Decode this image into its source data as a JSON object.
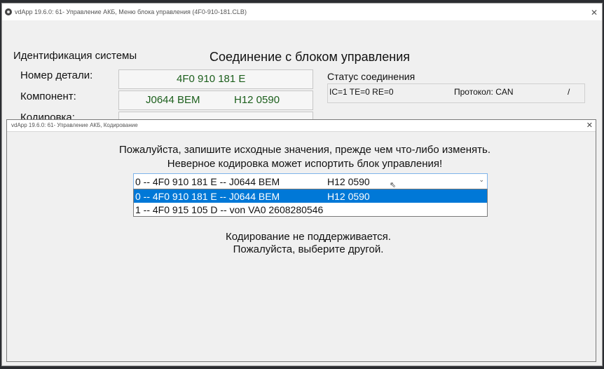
{
  "main_window": {
    "title": "vdApp 19.6.0: 61- Управление АКБ,  Меню блока управления (4F0-910-181.CLB)",
    "system_ident_label": "Идентификация системы",
    "connection_title": "Соединение с блоком управления",
    "part_number": {
      "label": "Номер детали:",
      "value": "4F0 910 181 E"
    },
    "component": {
      "label": "Компонент:",
      "name": "J0644 BEM",
      "version": "H12 0590"
    },
    "coding": {
      "label": "Кодировка:"
    },
    "status": {
      "title": "Статус соединения",
      "counters": "IC=1  TE=0   RE=0",
      "protocol": "Протокол: CAN",
      "spinner": "/"
    }
  },
  "dialog": {
    "title": "vdApp 19.6.0: 61- Управление АКБ,  Кодирование",
    "warning_line1": "Пожалуйста, запишите исходные значения, прежде чем что-либо изменять.",
    "warning_line2": "Неверное кодировка может испортить блок управления!",
    "dropdown": {
      "selected": {
        "main": "0 -- 4F0 910 181 E -- J0644 BEM",
        "version": "H12 0590"
      },
      "options": [
        {
          "main": "0 -- 4F0 910 181 E -- J0644 BEM",
          "version": "H12 0590",
          "selected": true
        },
        {
          "main": "1 -- 4F0 915 105 D -- von VA0  2608280546",
          "version": "",
          "selected": false
        }
      ]
    },
    "message_line1": "Кодирование не поддерживается.",
    "message_line2": "Пожалуйста, выберите другой."
  },
  "colors": {
    "accent": "#0078d7",
    "value_text": "#1c5f1c"
  },
  "icons": {
    "app": "app-logo-icon",
    "close": "close-icon",
    "dropdown": "chevron-down-icon",
    "cursor": "mouse-pointer-icon"
  }
}
